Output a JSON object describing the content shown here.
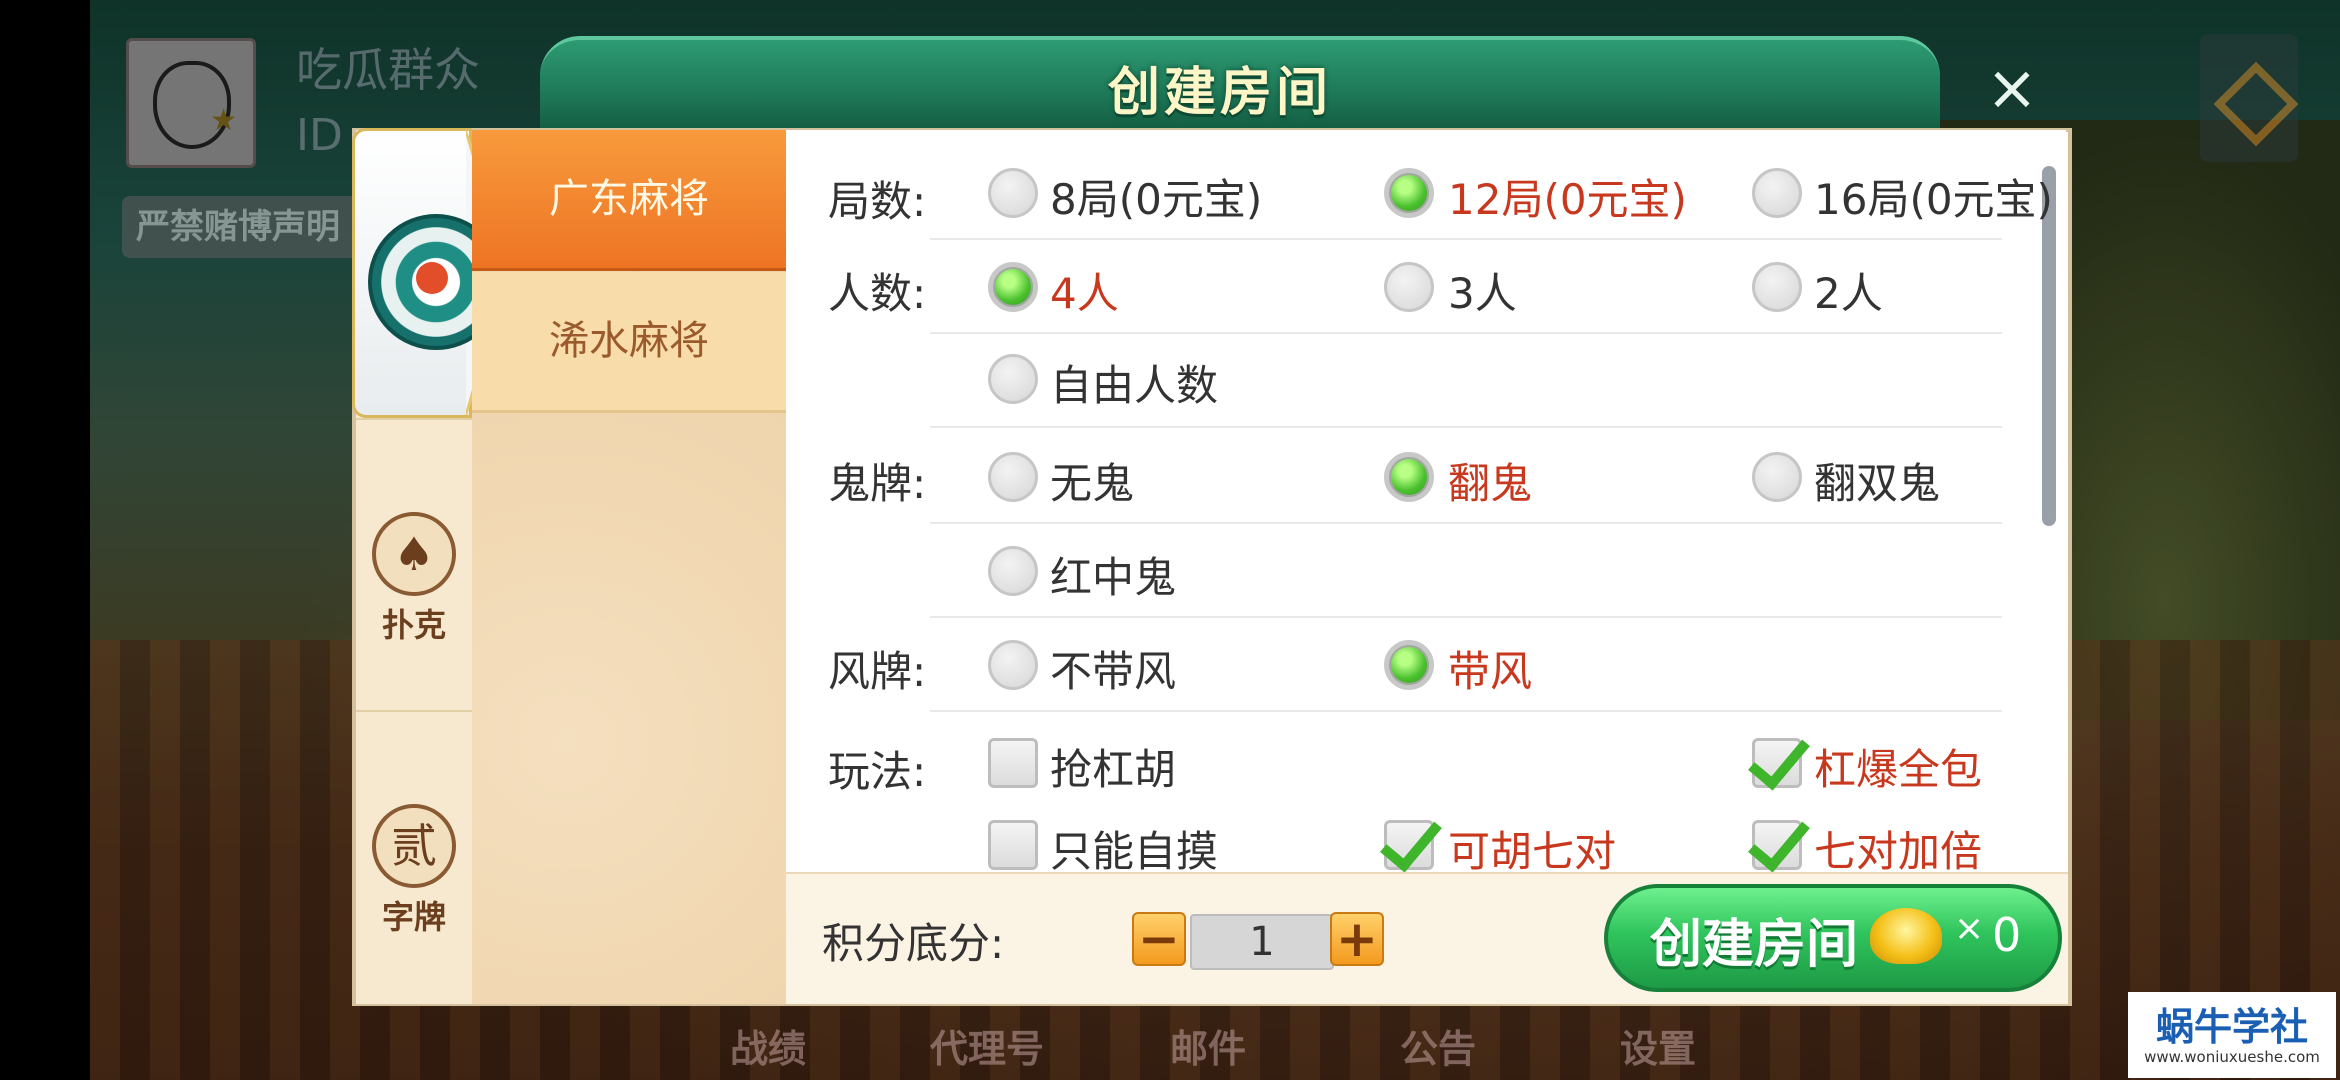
{
  "background": {
    "player_name": "吃瓜群众",
    "player_id_prefix": "ID",
    "gambling_notice": "严禁赌博声明",
    "bottom_nav": [
      "战绩",
      "代理号",
      "邮件",
      "公告",
      "设置"
    ]
  },
  "dialog": {
    "title": "创建房间",
    "close_label": "×"
  },
  "categories": [
    {
      "name": "麻将",
      "icon": "mahjong-tile-icon",
      "active": true
    },
    {
      "name": "扑克",
      "icon": "spade-icon",
      "glyph": "♠"
    },
    {
      "name": "字牌",
      "icon": "char-tile-icon",
      "glyph": "贰"
    }
  ],
  "game_tabs": [
    {
      "label": "广东麻将",
      "active": true
    },
    {
      "label": "浠水麻将",
      "active": false
    }
  ],
  "options": {
    "rounds": {
      "label": "局数:",
      "choices": [
        {
          "text": "8局(0元宝)",
          "selected": false
        },
        {
          "text": "12局(0元宝)",
          "selected": true
        },
        {
          "text": "16局(0元宝)",
          "selected": false
        }
      ]
    },
    "players": {
      "label": "人数:",
      "choices": [
        {
          "text": "4人",
          "selected": true
        },
        {
          "text": "3人",
          "selected": false
        },
        {
          "text": "2人",
          "selected": false
        },
        {
          "text": "自由人数",
          "selected": false
        }
      ]
    },
    "ghost": {
      "label": "鬼牌:",
      "choices": [
        {
          "text": "无鬼",
          "selected": false
        },
        {
          "text": "翻鬼",
          "selected": true
        },
        {
          "text": "翻双鬼",
          "selected": false
        },
        {
          "text": "红中鬼",
          "selected": false
        }
      ]
    },
    "wind": {
      "label": "风牌:",
      "choices": [
        {
          "text": "不带风",
          "selected": false
        },
        {
          "text": "带风",
          "selected": true
        }
      ]
    },
    "play": {
      "label": "玩法:",
      "choices": [
        {
          "text": "抢杠胡",
          "checked": false
        },
        {
          "text": "杠爆全包",
          "checked": true
        },
        {
          "text": "只能自摸",
          "checked": false
        },
        {
          "text": "可胡七对",
          "checked": true
        },
        {
          "text": "七对加倍",
          "checked": true
        }
      ]
    }
  },
  "bottom": {
    "score_label": "积分底分:",
    "minus": "−",
    "plus": "+",
    "score_value": "1",
    "create_label": "创建房间",
    "cost_times": "×",
    "cost_value": "0"
  },
  "watermark": {
    "title": "蜗牛学社",
    "url": "www.woniuxueshe.com"
  },
  "colors": {
    "title_bar": "#1f7a59",
    "active_tab": "#ee7424",
    "selected_text": "#c8381e",
    "radio_on": "#4cc22f",
    "create_button": "#2fc45c"
  }
}
